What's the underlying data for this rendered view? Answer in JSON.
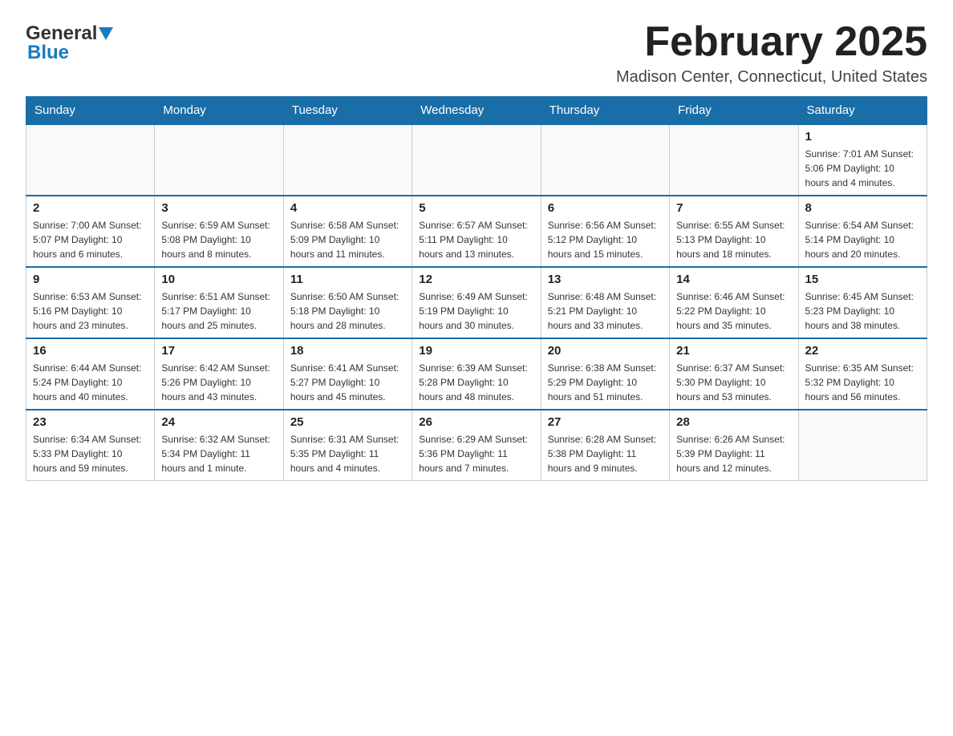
{
  "header": {
    "logo_general": "General",
    "logo_blue": "Blue",
    "title": "February 2025",
    "location": "Madison Center, Connecticut, United States"
  },
  "days_of_week": [
    "Sunday",
    "Monday",
    "Tuesday",
    "Wednesday",
    "Thursday",
    "Friday",
    "Saturday"
  ],
  "weeks": [
    [
      {
        "day": "",
        "info": ""
      },
      {
        "day": "",
        "info": ""
      },
      {
        "day": "",
        "info": ""
      },
      {
        "day": "",
        "info": ""
      },
      {
        "day": "",
        "info": ""
      },
      {
        "day": "",
        "info": ""
      },
      {
        "day": "1",
        "info": "Sunrise: 7:01 AM\nSunset: 5:06 PM\nDaylight: 10 hours\nand 4 minutes."
      }
    ],
    [
      {
        "day": "2",
        "info": "Sunrise: 7:00 AM\nSunset: 5:07 PM\nDaylight: 10 hours\nand 6 minutes."
      },
      {
        "day": "3",
        "info": "Sunrise: 6:59 AM\nSunset: 5:08 PM\nDaylight: 10 hours\nand 8 minutes."
      },
      {
        "day": "4",
        "info": "Sunrise: 6:58 AM\nSunset: 5:09 PM\nDaylight: 10 hours\nand 11 minutes."
      },
      {
        "day": "5",
        "info": "Sunrise: 6:57 AM\nSunset: 5:11 PM\nDaylight: 10 hours\nand 13 minutes."
      },
      {
        "day": "6",
        "info": "Sunrise: 6:56 AM\nSunset: 5:12 PM\nDaylight: 10 hours\nand 15 minutes."
      },
      {
        "day": "7",
        "info": "Sunrise: 6:55 AM\nSunset: 5:13 PM\nDaylight: 10 hours\nand 18 minutes."
      },
      {
        "day": "8",
        "info": "Sunrise: 6:54 AM\nSunset: 5:14 PM\nDaylight: 10 hours\nand 20 minutes."
      }
    ],
    [
      {
        "day": "9",
        "info": "Sunrise: 6:53 AM\nSunset: 5:16 PM\nDaylight: 10 hours\nand 23 minutes."
      },
      {
        "day": "10",
        "info": "Sunrise: 6:51 AM\nSunset: 5:17 PM\nDaylight: 10 hours\nand 25 minutes."
      },
      {
        "day": "11",
        "info": "Sunrise: 6:50 AM\nSunset: 5:18 PM\nDaylight: 10 hours\nand 28 minutes."
      },
      {
        "day": "12",
        "info": "Sunrise: 6:49 AM\nSunset: 5:19 PM\nDaylight: 10 hours\nand 30 minutes."
      },
      {
        "day": "13",
        "info": "Sunrise: 6:48 AM\nSunset: 5:21 PM\nDaylight: 10 hours\nand 33 minutes."
      },
      {
        "day": "14",
        "info": "Sunrise: 6:46 AM\nSunset: 5:22 PM\nDaylight: 10 hours\nand 35 minutes."
      },
      {
        "day": "15",
        "info": "Sunrise: 6:45 AM\nSunset: 5:23 PM\nDaylight: 10 hours\nand 38 minutes."
      }
    ],
    [
      {
        "day": "16",
        "info": "Sunrise: 6:44 AM\nSunset: 5:24 PM\nDaylight: 10 hours\nand 40 minutes."
      },
      {
        "day": "17",
        "info": "Sunrise: 6:42 AM\nSunset: 5:26 PM\nDaylight: 10 hours\nand 43 minutes."
      },
      {
        "day": "18",
        "info": "Sunrise: 6:41 AM\nSunset: 5:27 PM\nDaylight: 10 hours\nand 45 minutes."
      },
      {
        "day": "19",
        "info": "Sunrise: 6:39 AM\nSunset: 5:28 PM\nDaylight: 10 hours\nand 48 minutes."
      },
      {
        "day": "20",
        "info": "Sunrise: 6:38 AM\nSunset: 5:29 PM\nDaylight: 10 hours\nand 51 minutes."
      },
      {
        "day": "21",
        "info": "Sunrise: 6:37 AM\nSunset: 5:30 PM\nDaylight: 10 hours\nand 53 minutes."
      },
      {
        "day": "22",
        "info": "Sunrise: 6:35 AM\nSunset: 5:32 PM\nDaylight: 10 hours\nand 56 minutes."
      }
    ],
    [
      {
        "day": "23",
        "info": "Sunrise: 6:34 AM\nSunset: 5:33 PM\nDaylight: 10 hours\nand 59 minutes."
      },
      {
        "day": "24",
        "info": "Sunrise: 6:32 AM\nSunset: 5:34 PM\nDaylight: 11 hours\nand 1 minute."
      },
      {
        "day": "25",
        "info": "Sunrise: 6:31 AM\nSunset: 5:35 PM\nDaylight: 11 hours\nand 4 minutes."
      },
      {
        "day": "26",
        "info": "Sunrise: 6:29 AM\nSunset: 5:36 PM\nDaylight: 11 hours\nand 7 minutes."
      },
      {
        "day": "27",
        "info": "Sunrise: 6:28 AM\nSunset: 5:38 PM\nDaylight: 11 hours\nand 9 minutes."
      },
      {
        "day": "28",
        "info": "Sunrise: 6:26 AM\nSunset: 5:39 PM\nDaylight: 11 hours\nand 12 minutes."
      },
      {
        "day": "",
        "info": ""
      }
    ]
  ]
}
